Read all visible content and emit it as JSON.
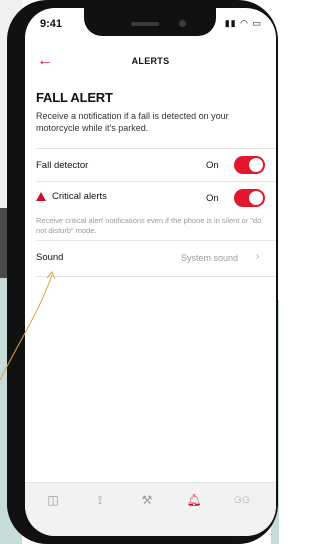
{
  "status_bar": {
    "time": "9:41",
    "icons": "▮▮ ◠ ▭"
  },
  "header": {
    "back_icon": "arrow-left-icon",
    "title": "ALERTS"
  },
  "fall_alert": {
    "title": "FALL ALERT",
    "description": "Receive a notification if a fall is detected on your motorcycle while it's parked."
  },
  "fall_detector": {
    "label": "Fall detector",
    "state": "On"
  },
  "critical_alerts": {
    "label": "Critical alerts",
    "state": "On",
    "description": "Receive critical alert notifications even if the phone is in silent or \"do not disturb\" mode."
  },
  "sound": {
    "label": "Sound",
    "value": "System sound",
    "chevron": "›"
  },
  "tabbar": {
    "items": [
      {
        "icon": "map-icon",
        "glyph": "◫"
      },
      {
        "icon": "route-icon",
        "glyph": "⟟"
      },
      {
        "icon": "wrench-icon",
        "glyph": "⚒"
      },
      {
        "icon": "bell-icon",
        "glyph": "🔔︎"
      },
      {
        "icon": "motorcycle-icon",
        "glyph": "⚆⚆"
      }
    ]
  },
  "colors": {
    "accent": "#e3162d",
    "muted": "#9a9a9a"
  }
}
